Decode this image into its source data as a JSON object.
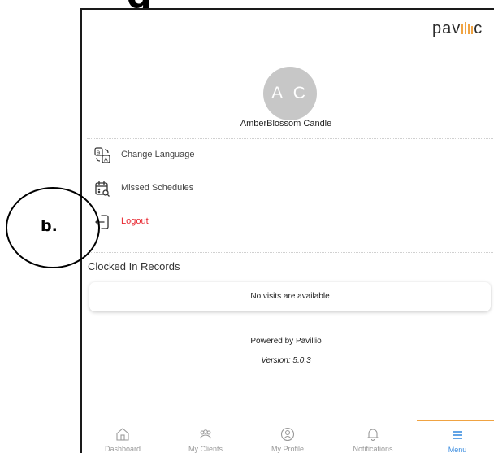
{
  "app": {
    "brand": "pavillio"
  },
  "profile": {
    "initials": "A C",
    "name": "AmberBlossom Candle"
  },
  "menu": {
    "items": [
      {
        "label": "Change Language",
        "icon": "translate-icon"
      },
      {
        "label": "Missed Schedules",
        "icon": "calendar-search-icon"
      },
      {
        "label": "Logout",
        "icon": "logout-icon"
      }
    ]
  },
  "clocked_in": {
    "title": "Clocked In Records",
    "empty_message": "No visits are available"
  },
  "footer": {
    "powered_by": "Powered by Pavillio",
    "version": "Version: 5.0.3"
  },
  "bottom_nav": {
    "items": [
      {
        "label": "Dashboard",
        "icon": "home-icon"
      },
      {
        "label": "My Clients",
        "icon": "clients-icon"
      },
      {
        "label": "My Profile",
        "icon": "profile-icon"
      },
      {
        "label": "Notifications",
        "icon": "bell-icon"
      },
      {
        "label": "Menu",
        "icon": "hamburger-menu-icon",
        "active": true
      }
    ]
  },
  "annotation": {
    "label": "b."
  },
  "colors": {
    "logout": "#e8262f",
    "nav_active_indicator": "#f0a342",
    "nav_active_label": "#3b8de0",
    "avatar_bg": "#c7c7c7",
    "brand_bars": "#f0a342"
  }
}
